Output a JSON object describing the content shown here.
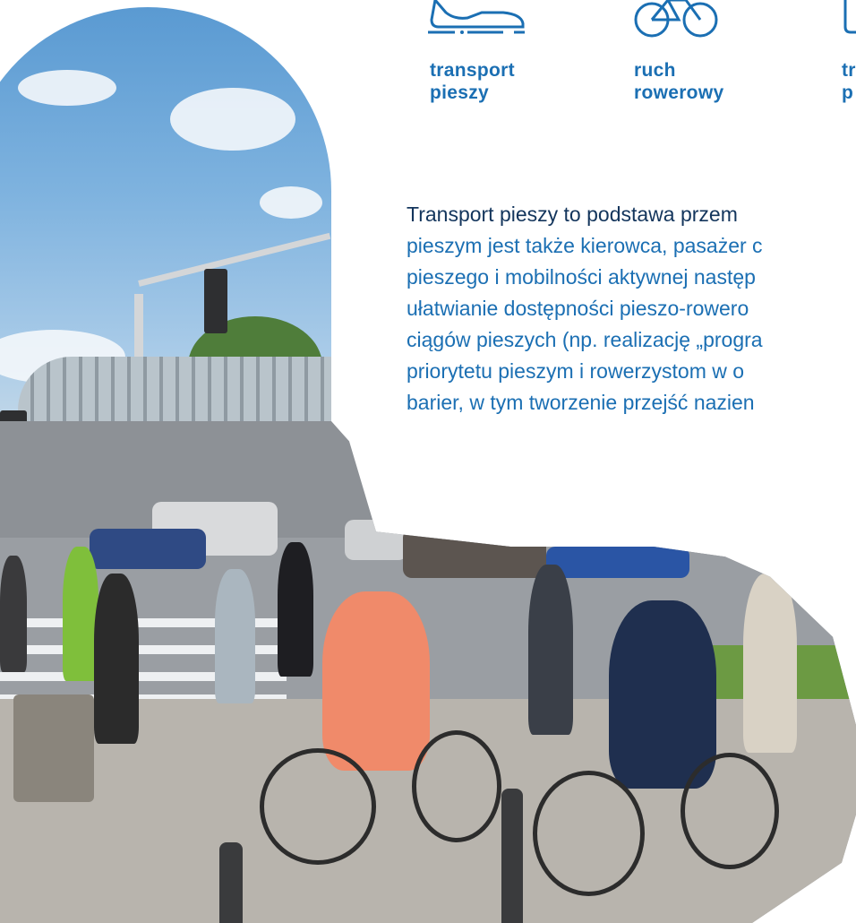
{
  "categories": [
    {
      "line1": "transport",
      "line2": "pieszy",
      "icon": "shoe-icon"
    },
    {
      "line1": "ruch",
      "line2": "rowerowy",
      "icon": "bicycle-icon"
    },
    {
      "line1": "tr",
      "line2": "p",
      "icon": "transit-icon"
    }
  ],
  "intro": {
    "lead": "Transport pieszy to podstawa przem",
    "lines": [
      "pieszym jest także kierowca, pasażer c",
      "pieszego i mobilności aktywnej następ",
      "ułatwianie dostępności pieszo-rowero",
      "ciągów pieszych (np. realizację „progra",
      "priorytetu pieszym i rowerzystom w o",
      "barier, w tym tworzenie przejść nazien"
    ]
  },
  "colors": {
    "accent": "#1b6fb3",
    "lead_text": "#13355c"
  }
}
